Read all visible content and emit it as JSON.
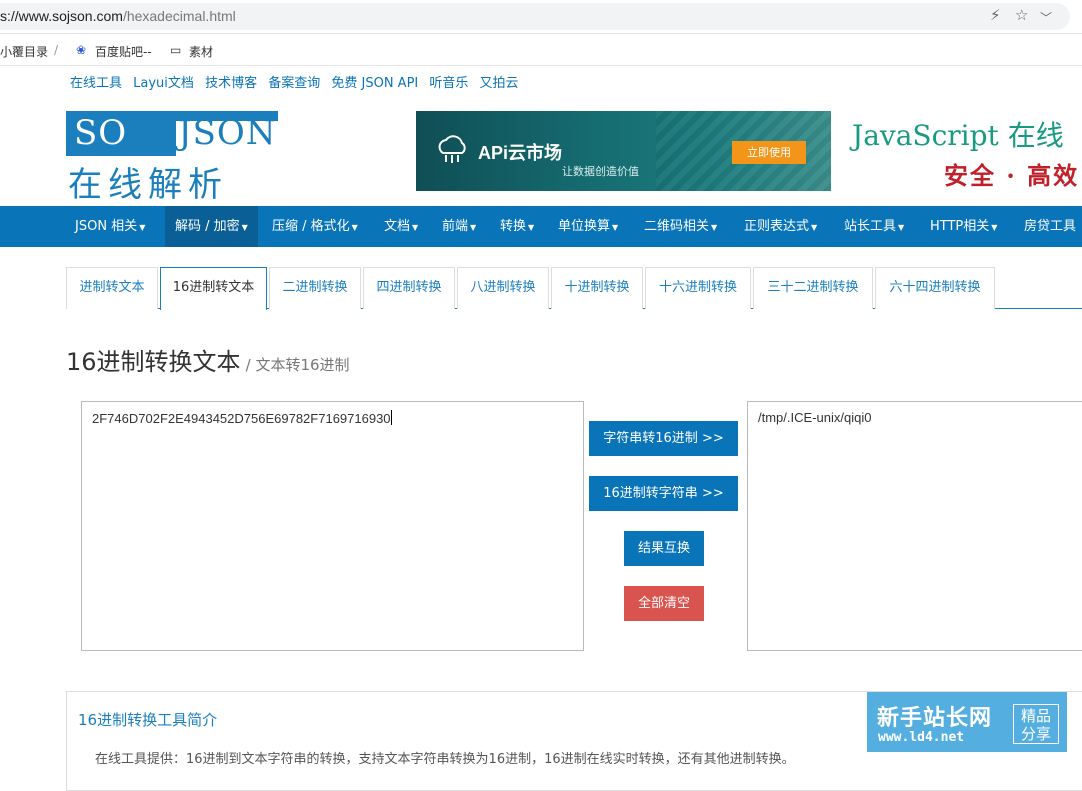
{
  "browser": {
    "url_prefix": "s://www.sojson.com",
    "url_path": "/hexadecimal.html"
  },
  "bookmarks": [
    "小覆目录",
    "/",
    "百度贴吧--",
    "素材"
  ],
  "top_links": [
    "在线工具",
    "Layui文档",
    "技术博客",
    "备案查询",
    "免费 JSON API",
    "听音乐",
    "又拍云"
  ],
  "header": {
    "logo_top_left": "SO",
    "logo_top_right": "JSON",
    "logo_bottom": "在线解析",
    "banner_title": "APi云市场",
    "banner_subtitle": "让数据创造价值",
    "banner_cta": "立即使用",
    "slogan_1": "JavaScript 在线",
    "slogan_2": "安全 · 高效"
  },
  "nav": {
    "items": [
      "JSON 相关",
      "解码 / 加密",
      "压缩 / 格式化",
      "文档",
      "前端",
      "转换",
      "单位换算",
      "二维码相关",
      "正则表达式",
      "站长工具",
      "HTTP相关",
      "房贷工具"
    ],
    "active_index": 1
  },
  "tabs": {
    "items": [
      "进制转文本",
      "16进制转文本",
      "二进制转换",
      "四进制转换",
      "八进制转换",
      "十进制转换",
      "十六进制转换",
      "三十二进制转换",
      "六十四进制转换"
    ],
    "active_index": 1
  },
  "page": {
    "title": "16进制转换文本",
    "subtitle": "/ 文本转16进制"
  },
  "converter": {
    "input_value": "2F746D702F2E4943452D756E69782F7169716930",
    "output_value": "/tmp/.ICE-unix/qiqi0",
    "btn_str_to_hex": "字符串转16进制 >>",
    "btn_hex_to_str": "16进制转字符串 >>",
    "btn_swap": "结果互换",
    "btn_clear": "全部清空"
  },
  "intro": {
    "title": "16进制转换工具简介",
    "description": "在线工具提供：16进制到文本字符串的转换，支持文本字符串转换为16进制，16进制在线实时转换，还有其他进制转换。"
  },
  "watermark": {
    "name": "新手站长网",
    "url": "www.ld4.net",
    "tag_1": "精品",
    "tag_2": "分享"
  },
  "colors": {
    "primary_blue": "#0a74b8",
    "danger_red": "#d9534f",
    "slogan_green": "#1a9a82",
    "slogan_red": "#c0202a"
  }
}
